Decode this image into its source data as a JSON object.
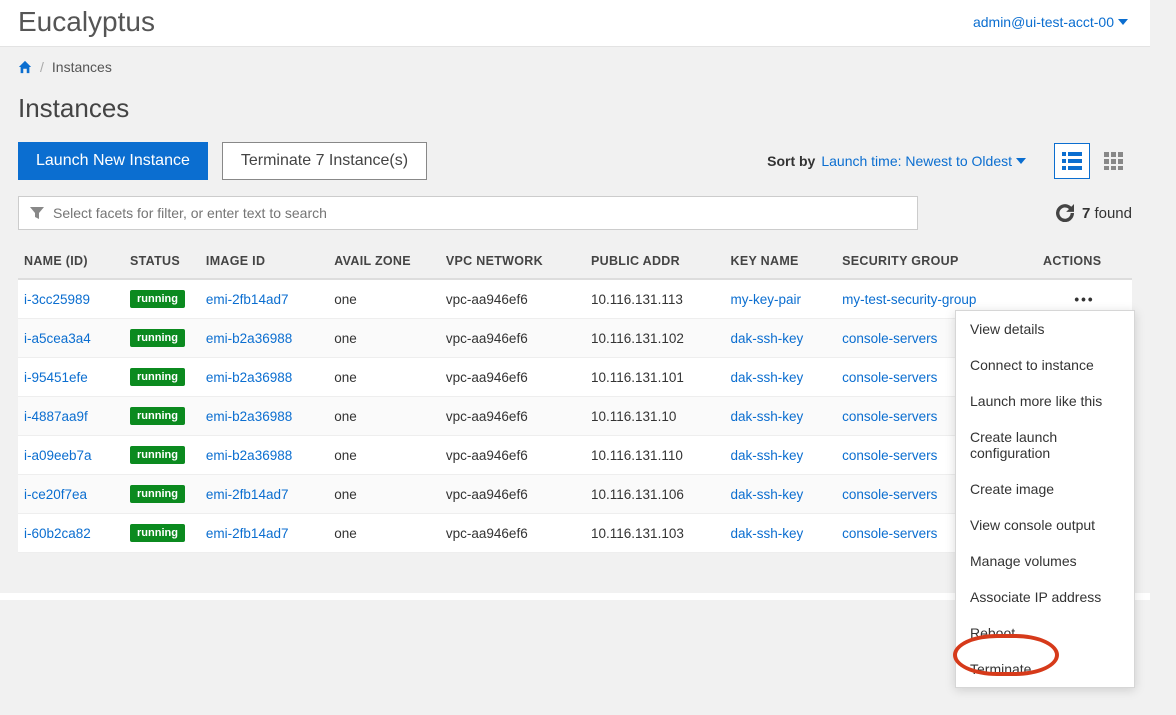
{
  "brand": "Eucalyptus",
  "user_label": "admin@ui-test-acct-00",
  "breadcrumb": {
    "current": "Instances"
  },
  "page_title": "Instances",
  "toolbar": {
    "launch_label": "Launch New Instance",
    "terminate_label": "Terminate 7 Instance(s)",
    "sort_prefix": "Sort by",
    "sort_value": "Launch time: Newest to Oldest"
  },
  "search": {
    "placeholder": "Select facets for filter, or enter text to search"
  },
  "found": {
    "count": "7",
    "suffix": "found"
  },
  "columns": {
    "name": "NAME (ID)",
    "status": "STATUS",
    "image": "IMAGE ID",
    "zone": "AVAIL ZONE",
    "vpc": "VPC NETWORK",
    "ip": "PUBLIC ADDR",
    "key": "KEY NAME",
    "sg": "SECURITY GROUP",
    "actions": "ACTIONS"
  },
  "status_badge": "running",
  "rows": [
    {
      "name": "i-3cc25989",
      "image": "emi-2fb14ad7",
      "zone": "one",
      "vpc": "vpc-aa946ef6",
      "ip": "10.116.131.113",
      "key": "my-key-pair",
      "sg": "my-test-security-group",
      "show_dots": true
    },
    {
      "name": "i-a5cea3a4",
      "image": "emi-b2a36988",
      "zone": "one",
      "vpc": "vpc-aa946ef6",
      "ip": "10.116.131.102",
      "key": "dak-ssh-key",
      "sg": "console-servers",
      "show_dots": false
    },
    {
      "name": "i-95451efe",
      "image": "emi-b2a36988",
      "zone": "one",
      "vpc": "vpc-aa946ef6",
      "ip": "10.116.131.101",
      "key": "dak-ssh-key",
      "sg": "console-servers",
      "show_dots": false
    },
    {
      "name": "i-4887aa9f",
      "image": "emi-b2a36988",
      "zone": "one",
      "vpc": "vpc-aa946ef6",
      "ip": "10.116.131.10",
      "key": "dak-ssh-key",
      "sg": "console-servers",
      "show_dots": false
    },
    {
      "name": "i-a09eeb7a",
      "image": "emi-b2a36988",
      "zone": "one",
      "vpc": "vpc-aa946ef6",
      "ip": "10.116.131.110",
      "key": "dak-ssh-key",
      "sg": "console-servers",
      "show_dots": false
    },
    {
      "name": "i-ce20f7ea",
      "image": "emi-2fb14ad7",
      "zone": "one",
      "vpc": "vpc-aa946ef6",
      "ip": "10.116.131.106",
      "key": "dak-ssh-key",
      "sg": "console-servers",
      "show_dots": false
    },
    {
      "name": "i-60b2ca82",
      "image": "emi-2fb14ad7",
      "zone": "one",
      "vpc": "vpc-aa946ef6",
      "ip": "10.116.131.103",
      "key": "dak-ssh-key",
      "sg": "console-servers",
      "show_dots": false
    }
  ],
  "menu": {
    "items": [
      "View details",
      "Connect to instance",
      "Launch more like this",
      "Create launch configuration",
      "Create image",
      "View console output",
      "Manage volumes",
      "Associate IP address",
      "Reboot",
      "Terminate"
    ]
  }
}
